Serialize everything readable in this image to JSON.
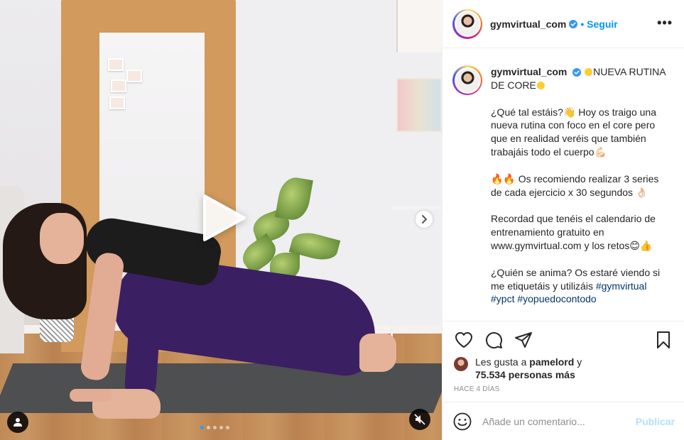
{
  "post": {
    "username": "gymvirtual_com",
    "follow_label": "Seguir",
    "more_label": "•••"
  },
  "caption": {
    "username": "gymvirtual_com",
    "title": "NUEVA RUTINA DE CORE",
    "paragraph1": "¿Qué tal estáis?👋 Hoy os traigo una nueva rutina con foco en el core pero que en realidad veréis que también trabajáis todo el cuerpo💪🏻",
    "paragraph2": "🔥🔥 Os recomiendo realizar 3 series de cada ejercicio x 30 segundos 👌🏻",
    "paragraph3": "Recordad que tenéis el calendario de entrenamiento gratuito en www.gymvirtual.com y los retos😊👍",
    "paragraph4_text": "¿Quién se anima? Os estaré viendo si me etiquetáis y utilizáis",
    "hashtags": [
      "#gymvirtual",
      "#ypct",
      "#yopuedocontodo"
    ]
  },
  "likes": {
    "prefix": "Les gusta a",
    "liker": "pamelord",
    "conjunction": "y",
    "others": "75.534 personas más"
  },
  "time_ago": "HACE 4 DÍAS",
  "comment": {
    "placeholder": "Añade un comentario...",
    "publish_label": "Publicar"
  },
  "carousel": {
    "total_slides": 5,
    "current_slide": 1
  },
  "colors": {
    "accent": "#0095f6",
    "publish_disabled": "#b2dffc",
    "hashtag": "#00376b",
    "verified": "#3897f0"
  },
  "icons": [
    "play-icon",
    "next-arrow-icon",
    "tagged-user-icon",
    "muted-icon",
    "verified-badge-icon",
    "heart-icon",
    "comment-icon",
    "share-icon",
    "bookmark-icon",
    "emoji-icon",
    "more-icon"
  ]
}
